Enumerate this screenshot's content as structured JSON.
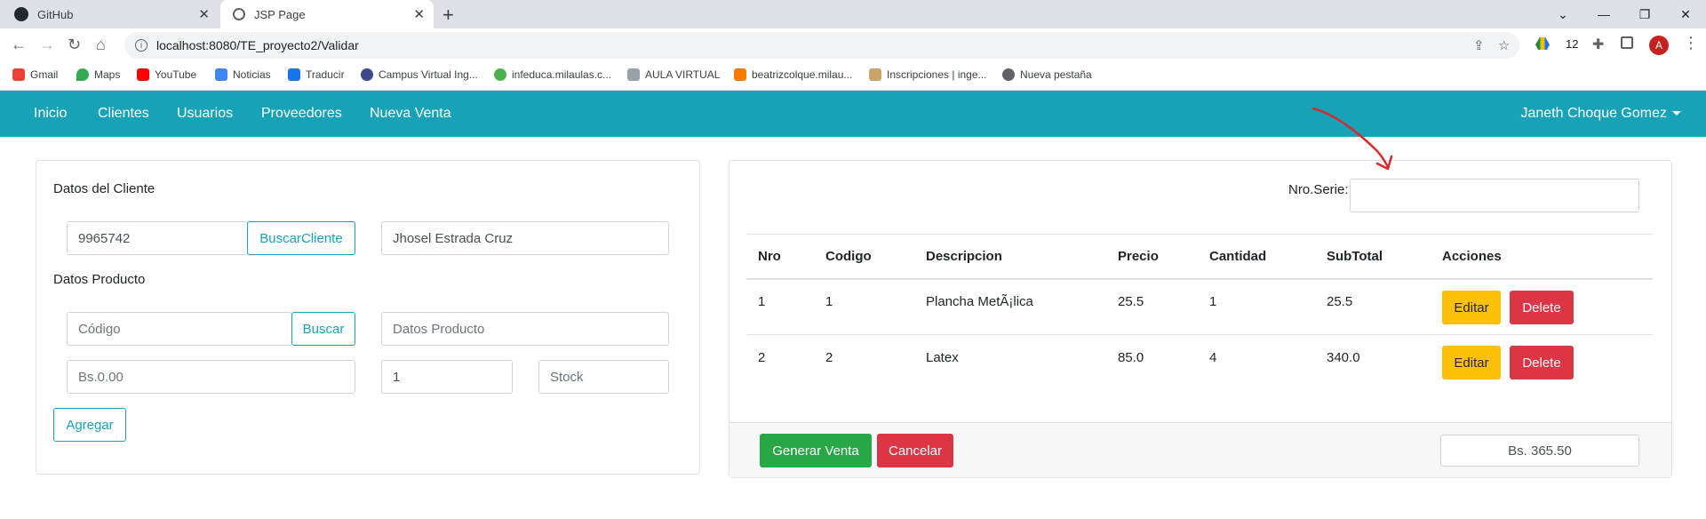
{
  "browser": {
    "tabs": [
      {
        "title": "GitHub",
        "icon": "github-icon"
      },
      {
        "title": "JSP Page",
        "icon": "globe-icon"
      }
    ],
    "url": "localhost:8080/TE_proyecto2/Validar",
    "extension_badge": "12",
    "profile_initial": "A",
    "bookmarks": [
      "Gmail",
      "Maps",
      "YouTube",
      "Noticias",
      "Traducir",
      "Campus Virtual Ing...",
      "infeduca.milaulas.c...",
      "AULA VIRTUAL",
      "beatrizcolque.milau...",
      "Inscripciones | inge...",
      "Nueva pestaña"
    ]
  },
  "navbar": {
    "links": [
      "Inicio",
      "Clientes",
      "Usuarios",
      "Proveedores",
      "Nueva Venta"
    ],
    "user": "Janeth Choque Gomez"
  },
  "client": {
    "section_label": "Datos del Cliente",
    "code": "9965742",
    "search_button": "BuscarCliente",
    "name": "Jhosel Estrada Cruz"
  },
  "product": {
    "section_label": "Datos Producto",
    "code_placeholder": "Código",
    "search_button": "Buscar",
    "data_placeholder": "Datos Producto",
    "price_placeholder": "Bs.0.00",
    "quantity": "1",
    "stock_placeholder": "Stock",
    "add_button": "Agregar"
  },
  "sale": {
    "serie_label": "Nro.Serie:",
    "serie_value": "",
    "columns": [
      "Nro",
      "Codigo",
      "Descripcion",
      "Precio",
      "Cantidad",
      "SubTotal",
      "Acciones"
    ],
    "rows": [
      {
        "nro": "1",
        "codigo": "1",
        "descripcion": "Plancha MetÃ¡lica",
        "precio": "25.5",
        "cantidad": "1",
        "subtotal": "25.5"
      },
      {
        "nro": "2",
        "codigo": "2",
        "descripcion": "Latex",
        "precio": "85.0",
        "cantidad": "4",
        "subtotal": "340.0"
      }
    ],
    "edit_label": "Editar",
    "delete_label": "Delete",
    "generate_button": "Generar Venta",
    "cancel_button": "Cancelar",
    "total": "Bs. 365.50"
  },
  "colors": {
    "navbar": "#17a2b8",
    "success": "#28a745",
    "danger": "#dc3545",
    "warning": "#ffc107",
    "annotation": "#d62b2b"
  }
}
